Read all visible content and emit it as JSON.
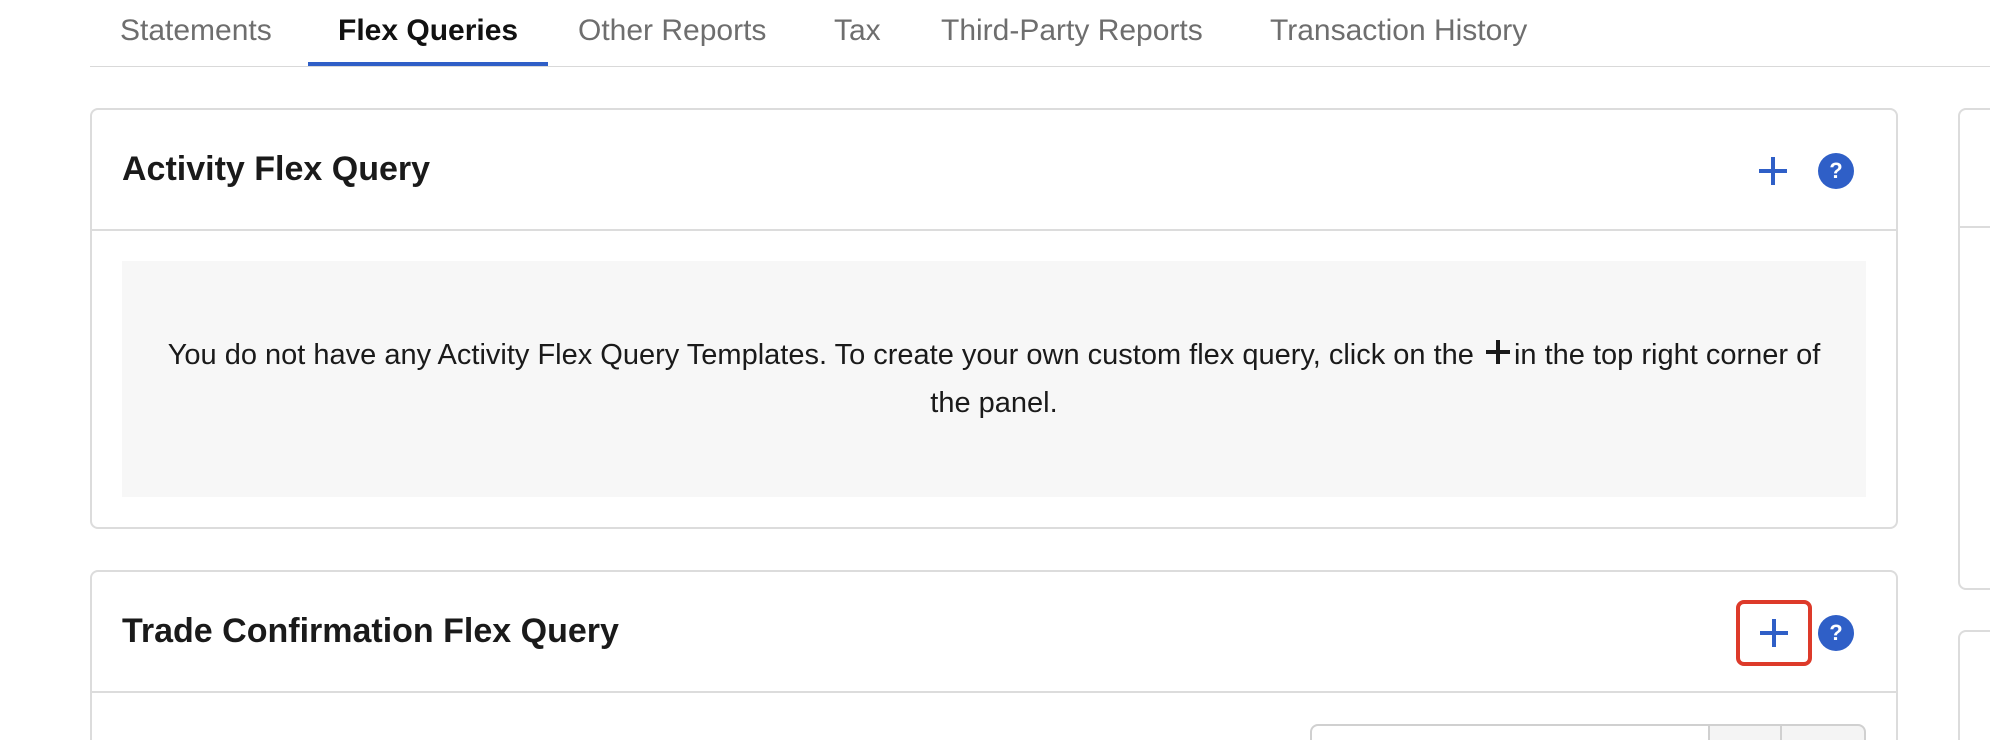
{
  "tabs": [
    {
      "label": "Statements",
      "active": false
    },
    {
      "label": "Flex Queries",
      "active": true
    },
    {
      "label": "Other Reports",
      "active": false
    },
    {
      "label": "Tax",
      "active": false
    },
    {
      "label": "Third-Party Reports",
      "active": false
    },
    {
      "label": "Transaction History",
      "active": false
    }
  ],
  "activity_panel": {
    "title": "Activity Flex Query",
    "empty_text_before": "You do not have any Activity Flex Query Templates. To create your own custom flex query, click on the ",
    "empty_text_after": "in the top right corner of the panel.",
    "help_label": "?"
  },
  "trade_panel": {
    "title": "Trade Confirmation Flex Query",
    "help_label": "?"
  },
  "colors": {
    "accent": "#2f5fc7",
    "highlight": "#dd3a2a",
    "empty_bg": "#f7f7f7",
    "border": "#dcdcdc"
  },
  "icons": {
    "add": "plus-icon",
    "help": "question-circle-icon"
  }
}
